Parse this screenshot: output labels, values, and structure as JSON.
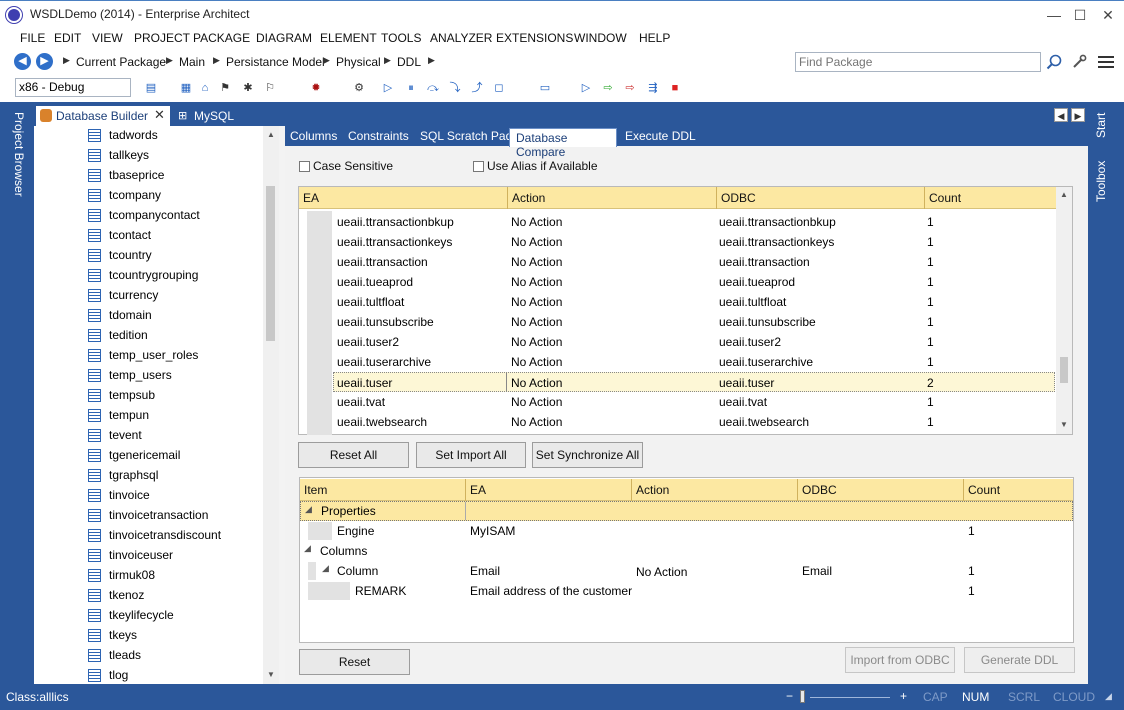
{
  "window": {
    "title": "WSDLDemo (2014) - Enterprise Architect",
    "controls": {
      "minimize": "—",
      "maximize": "☐",
      "close": "✕"
    }
  },
  "menu": [
    "FILE",
    "EDIT",
    "VIEW",
    "PROJECT",
    "PACKAGE",
    "DIAGRAM",
    "ELEMENT",
    "TOOLS",
    "ANALYZER",
    "EXTENSIONS",
    "WINDOW",
    "HELP"
  ],
  "breadcrumb": [
    "Current Package",
    "Main",
    "Persistance Model",
    "Physical",
    "DDL"
  ],
  "find_package": {
    "placeholder": "Find Package"
  },
  "toolbar": {
    "debug_config": "x86 - Debug"
  },
  "side_tabs": {
    "left": "Project Browser",
    "right_start": "Start",
    "right_toolbox": "Toolbox"
  },
  "doc_tabs": {
    "active": "Database Builder",
    "inactive": "MySQL"
  },
  "tree_items": [
    "tadwords",
    "tallkeys",
    "tbaseprice",
    "tcompany",
    "tcompanycontact",
    "tcontact",
    "tcountry",
    "tcountrygrouping",
    "tcurrency",
    "tdomain",
    "tedition",
    "temp_user_roles",
    "temp_users",
    "tempsub",
    "tempun",
    "tevent",
    "tgenericemail",
    "tgraphsql",
    "tinvoice",
    "tinvoicetransaction",
    "tinvoicetransdiscount",
    "tinvoiceuser",
    "tirmuk08",
    "tkenoz",
    "tkeylifecycle",
    "tkeys",
    "tleads",
    "tlog"
  ],
  "sub_tabs": [
    "Columns",
    "Constraints",
    "SQL Scratch Pad",
    "Database Compare",
    "Execute DDL"
  ],
  "options": {
    "case_sensitive": "Case Sensitive",
    "use_alias": "Use Alias if Available"
  },
  "compare_grid": {
    "headers": [
      "EA",
      "Action",
      "ODBC",
      "Count"
    ],
    "rows": [
      [
        "ueaii.ttransactionbkup",
        "No Action",
        "ueaii.ttransactionbkup",
        "1"
      ],
      [
        "ueaii.ttransactionkeys",
        "No Action",
        "ueaii.ttransactionkeys",
        "1"
      ],
      [
        "ueaii.ttransaction",
        "No Action",
        "ueaii.ttransaction",
        "1"
      ],
      [
        "ueaii.tueaprod",
        "No Action",
        "ueaii.tueaprod",
        "1"
      ],
      [
        "ueaii.tultfloat",
        "No Action",
        "ueaii.tultfloat",
        "1"
      ],
      [
        "ueaii.tunsubscribe",
        "No Action",
        "ueaii.tunsubscribe",
        "1"
      ],
      [
        "ueaii.tuser2",
        "No Action",
        "ueaii.tuser2",
        "1"
      ],
      [
        "ueaii.tuserarchive",
        "No Action",
        "ueaii.tuserarchive",
        "1"
      ],
      [
        "ueaii.tuser",
        "No Action",
        "ueaii.tuser",
        "2"
      ],
      [
        "ueaii.tvat",
        "No Action",
        "ueaii.tvat",
        "1"
      ],
      [
        "ueaii.twebsearch",
        "No Action",
        "ueaii.twebsearch",
        "1"
      ]
    ]
  },
  "compare_buttons": {
    "reset_all": "Reset All",
    "set_import_all": "Set Import All",
    "set_synchronize_all": "Set Synchronize All"
  },
  "detail_grid": {
    "headers": [
      "Item",
      "EA",
      "Action",
      "ODBC",
      "Count"
    ],
    "properties_label": "Properties",
    "engine": {
      "item": "Engine",
      "ea": "MyISAM",
      "count": "1"
    },
    "columns_label": "Columns",
    "column": {
      "item": "Column",
      "ea": "Email",
      "action": "No Action",
      "odbc": "Email",
      "count": "1"
    },
    "remark": {
      "item": "REMARK",
      "ea": "Email address of the customer",
      "count": "1"
    }
  },
  "bottom_buttons": {
    "reset": "Reset",
    "import_from_odbc": "Import from ODBC",
    "generate_ddl": "Generate DDL"
  },
  "status": {
    "left": "Class:alllics",
    "zoom_minus": "−",
    "zoom_plus": "+",
    "cap": "CAP",
    "num": "NUM",
    "scrl": "SCRL",
    "cloud": "CLOUD"
  },
  "colors": {
    "frame_blue": "#2b579a",
    "grid_header": "#fce8a2",
    "selected_row": "#fdf7d6"
  }
}
